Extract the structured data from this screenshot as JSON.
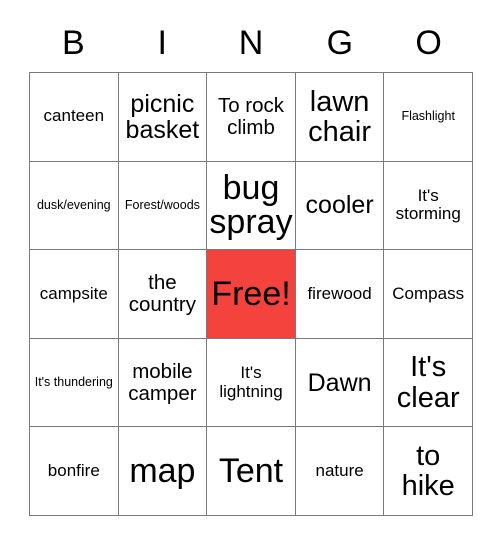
{
  "card": {
    "type": "bingo-card",
    "header_letters": [
      "B",
      "I",
      "N",
      "G",
      "O"
    ],
    "grid_size": "5x5",
    "free_space_color": "#f4433c",
    "border_color": "#7a7a7a",
    "background_color": "#ffffff",
    "rows": [
      [
        {
          "text": "canteen",
          "size": "sm",
          "free": false
        },
        {
          "text": "picnic basket",
          "size": "lg",
          "free": false
        },
        {
          "text": "To rock climb",
          "size": "md",
          "free": false
        },
        {
          "text": "lawn chair",
          "size": "xl",
          "free": false
        },
        {
          "text": "Flashlight",
          "size": "xs",
          "free": false
        }
      ],
      [
        {
          "text": "dusk/evening",
          "size": "xs",
          "free": false
        },
        {
          "text": "Forest/woods",
          "size": "xs",
          "free": false
        },
        {
          "text": "bug spray",
          "size": "xxl",
          "free": false
        },
        {
          "text": "cooler",
          "size": "lg",
          "free": false
        },
        {
          "text": "It's storming",
          "size": "sm",
          "free": false
        }
      ],
      [
        {
          "text": "campsite",
          "size": "sm",
          "free": false
        },
        {
          "text": "the country",
          "size": "md",
          "free": false
        },
        {
          "text": "Free!",
          "size": "xxl",
          "free": true
        },
        {
          "text": "firewood",
          "size": "sm",
          "free": false
        },
        {
          "text": "Compass",
          "size": "sm",
          "free": false
        }
      ],
      [
        {
          "text": "It's thundering",
          "size": "xs",
          "free": false
        },
        {
          "text": "mobile camper",
          "size": "md",
          "free": false
        },
        {
          "text": "It's lightning",
          "size": "sm",
          "free": false
        },
        {
          "text": "Dawn",
          "size": "lg",
          "free": false
        },
        {
          "text": "It's clear",
          "size": "xl",
          "free": false
        }
      ],
      [
        {
          "text": "bonfire",
          "size": "sm",
          "free": false
        },
        {
          "text": "map",
          "size": "xxl",
          "free": false
        },
        {
          "text": "Tent",
          "size": "xxl",
          "free": false
        },
        {
          "text": "nature",
          "size": "sm",
          "free": false
        },
        {
          "text": "to hike",
          "size": "xl",
          "free": false
        }
      ]
    ]
  }
}
